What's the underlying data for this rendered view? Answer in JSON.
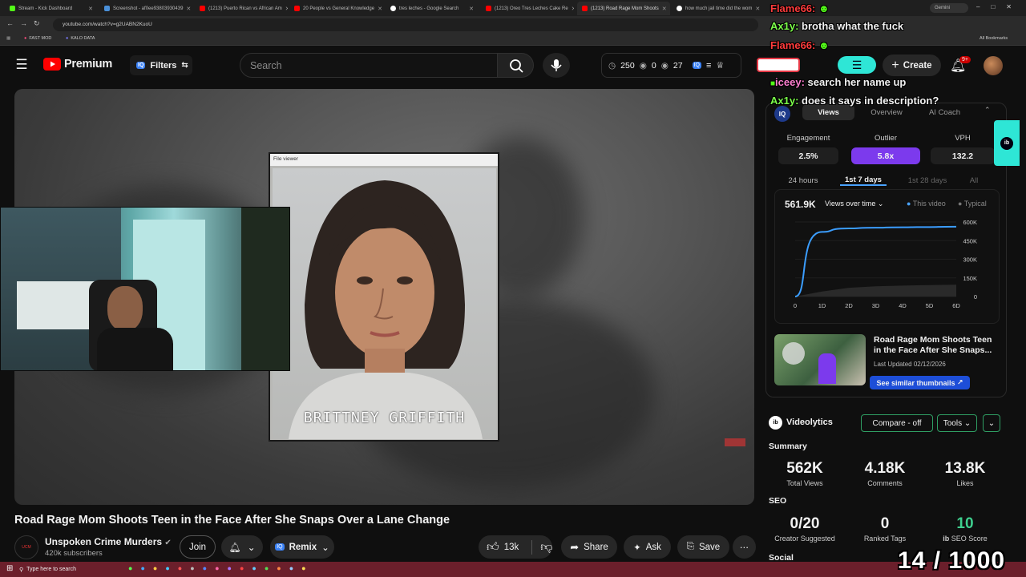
{
  "browser": {
    "tabs": [
      {
        "label": "Stream - Kick Dashboard",
        "color": "#53fc18"
      },
      {
        "label": "Screenshot - af0ee93803930439",
        "color": "#4a90d9"
      },
      {
        "label": "(1213) Puerto Rican vs African Am",
        "color": "#ff0000"
      },
      {
        "label": "20 People vs General Knowledge",
        "color": "#ff0000"
      },
      {
        "label": "tres leches - Google Search",
        "color": "#ffffff"
      },
      {
        "label": "(1213) Oreo Tres Leches Cake Re",
        "color": "#ff0000"
      },
      {
        "label": "(1213) Road Rage Mom Shoots",
        "color": "#ff0000"
      },
      {
        "label": "how much jail time did the wom",
        "color": "#ffffff"
      }
    ],
    "gemini": "Gemini",
    "url": "youtube.com/watch?v=g2UABN2KuoU",
    "bookmarks": [
      "FAST MOD",
      "KALO DATA"
    ],
    "all_bookmarks": "All Bookmarks"
  },
  "header": {
    "logo_text": "Premium",
    "filters": "Filters",
    "search_placeholder": "Search",
    "stats": [
      "250",
      "0",
      "27"
    ],
    "create": "Create",
    "notif_badge": "9+"
  },
  "video": {
    "file_viewer_title": "File viewer",
    "mugshot_name": "BRITTNEY GRIFFITH",
    "title": "Road Rage Mom Shoots Teen in the Face After She Snaps Over a Lane Change"
  },
  "channel": {
    "name": "Unspoken Crime Murders",
    "subs": "420k subscribers",
    "join": "Join",
    "remix": "Remix",
    "likes": "13k",
    "share": "Share",
    "ask": "Ask",
    "save": "Save"
  },
  "panel": {
    "tabs": [
      "Views",
      "Overview",
      "AI Coach"
    ],
    "metrics": [
      {
        "label": "Engagement",
        "value": "2.5%"
      },
      {
        "label": "Outlier",
        "value": "5.8x"
      },
      {
        "label": "VPH",
        "value": "132.2"
      }
    ],
    "ranges": [
      "24 hours",
      "1st 7 days",
      "1st 28 days",
      "All"
    ],
    "total": "561.9K",
    "view_select": "Views over time",
    "legend": [
      "This video",
      "Typical"
    ],
    "similar_title": "Road Rage Mom Shoots Teen in the Face After She Snaps...",
    "last_updated": "Last Updated 02/12/2026",
    "similar_button": "See similar thumbnails"
  },
  "chart_data": {
    "type": "line",
    "x": [
      "0",
      "1D",
      "2D",
      "3D",
      "4D",
      "5D",
      "6D"
    ],
    "ylim": [
      0,
      600000
    ],
    "yticks": [
      "600K",
      "450K",
      "300K",
      "150K",
      "0"
    ],
    "series": [
      {
        "name": "This video",
        "values": [
          0,
          520000,
          548000,
          554000,
          557000,
          559000,
          561900
        ]
      },
      {
        "name": "Typical",
        "values": [
          0,
          40000,
          70000,
          82000,
          88000,
          92000,
          95000
        ]
      }
    ]
  },
  "videolytics": {
    "brand": "Videolytics",
    "compare": "Compare - off",
    "tools": "Tools",
    "summary": "Summary",
    "stats": [
      {
        "value": "562K",
        "label": "Total Views"
      },
      {
        "value": "4.18K",
        "label": "Comments"
      },
      {
        "value": "13.8K",
        "label": "Likes"
      }
    ],
    "seo": "SEO",
    "seo_stats": [
      {
        "value": "0/20",
        "label": "Creator Suggested"
      },
      {
        "value": "0",
        "label": "Ranked Tags"
      },
      {
        "value": "10",
        "label": "SEO Score"
      }
    ],
    "social": "Social"
  },
  "chat": [
    {
      "user": "Flame66:",
      "text": "",
      "color": "#ff3b3b"
    },
    {
      "user": "Ax1y:",
      "text": "brotha what the fuck",
      "color": "#7cff4a"
    },
    {
      "user": "Flame66:",
      "text": "",
      "color": "#ff3b3b"
    },
    {
      "user": "iceey:",
      "text": "search her name up",
      "color": "#ff7fd0"
    },
    {
      "user": "Ax1y:",
      "text": "does it says in description?",
      "color": "#7cff4a"
    }
  ],
  "counter": "14 / 1000",
  "taskbar": {
    "search": "Type here to search"
  }
}
